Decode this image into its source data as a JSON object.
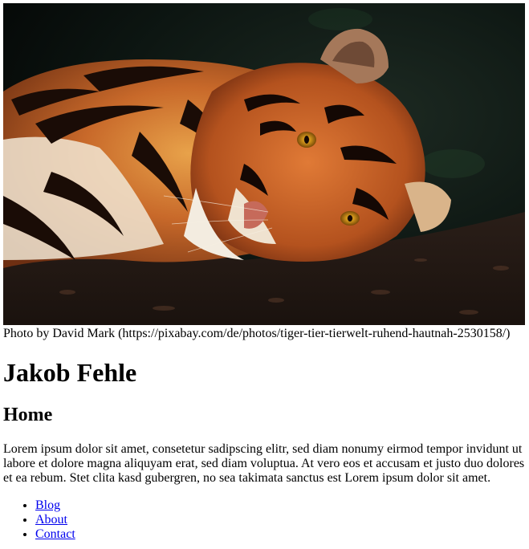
{
  "hero": {
    "image_subject": "tiger-lying-on-ground",
    "caption": "Photo by David Mark (https://pixabay.com/de/photos/tiger-tier-tierwelt-ruhend-hautnah-2530158/)"
  },
  "header": {
    "site_title": "Jakob Fehle",
    "page_title": "Home"
  },
  "main": {
    "body_text": "Lorem ipsum dolor sit amet, consetetur sadipscing elitr, sed diam nonumy eirmod tempor invidunt ut labore et dolore magna aliquyam erat, sed diam voluptua. At vero eos et accusam et justo duo dolores et ea rebum. Stet clita kasd gubergren, no sea takimata sanctus est Lorem ipsum dolor sit amet."
  },
  "nav": {
    "items": [
      {
        "label": "Blog"
      },
      {
        "label": "About"
      },
      {
        "label": "Contact"
      }
    ]
  },
  "colors": {
    "link": "#0000ee",
    "text": "#000000",
    "background": "#ffffff"
  }
}
